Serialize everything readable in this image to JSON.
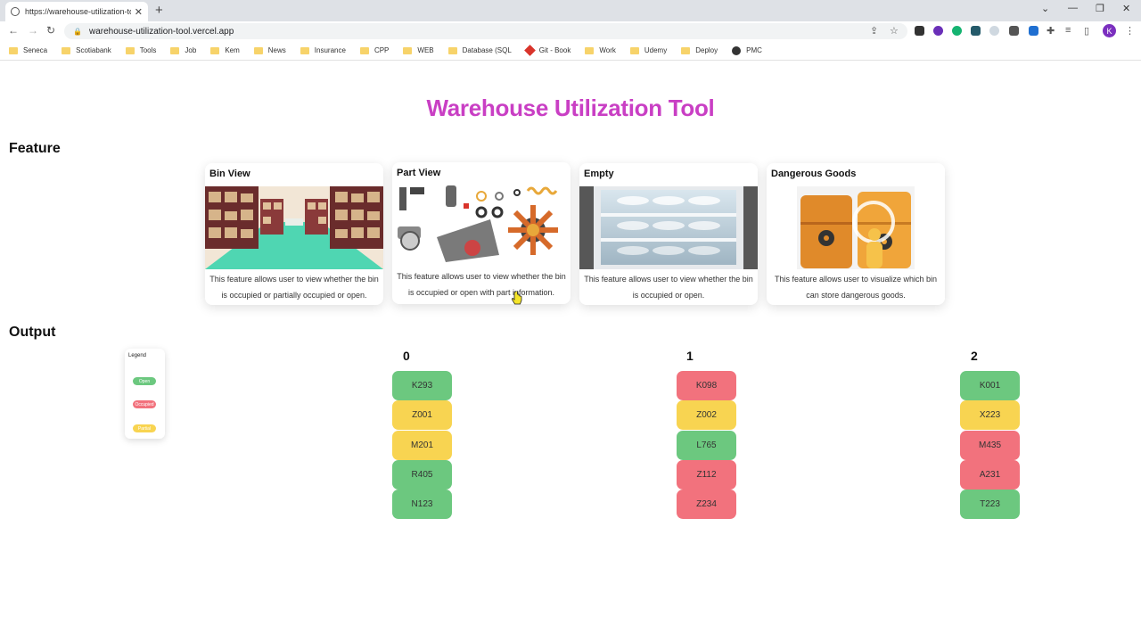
{
  "browser": {
    "tab_title": "https://warehouse-utilization-to...",
    "url": "warehouse-utilization-tool.vercel.app",
    "profile_initial": "K",
    "bookmarks": [
      "Seneca",
      "Scotiabank",
      "Tools",
      "Job",
      "Kem",
      "News",
      "Insurance",
      "CPP",
      "WEB",
      "Database (SQL",
      "Git - Book",
      "Work",
      "Udemy",
      "Deploy",
      "PMC"
    ]
  },
  "page": {
    "title": "Warehouse Utilization Tool",
    "feature_heading": "Feature",
    "output_heading": "Output"
  },
  "features": [
    {
      "title": "Bin View",
      "description": "This feature allows user to view whether the bin is occupied or partially occupied or open.",
      "image": "warehouse-shelves-illustration"
    },
    {
      "title": "Part View",
      "description": "This feature allows user to view whether the bin is occupied or open with part information.",
      "image": "machine-parts-illustration"
    },
    {
      "title": "Empty",
      "description": "This feature allows user to view whether the bin is occupied or open.",
      "image": "empty-shelf-illustration"
    },
    {
      "title": "Dangerous Goods",
      "description": "This feature allows user to visualize which bin can store dangerous goods.",
      "image": "hazard-barrels-illustration"
    }
  ],
  "legend": {
    "title": "Legend",
    "items": [
      {
        "label": "Open",
        "color": "#6cc87f"
      },
      {
        "label": "Occupied",
        "color": "#f2727d"
      },
      {
        "label": "Partial",
        "color": "#f8d451"
      }
    ]
  },
  "colors": {
    "open": "#6cc87f",
    "occupied": "#f2727d",
    "partial": "#f8d451",
    "title": "#c93fc4"
  },
  "output": {
    "columns": [
      {
        "label": "0",
        "bins": [
          {
            "code": "K293",
            "status": "open"
          },
          {
            "code": "Z001",
            "status": "partial"
          },
          {
            "code": "M201",
            "status": "partial"
          },
          {
            "code": "R405",
            "status": "open"
          },
          {
            "code": "N123",
            "status": "open"
          }
        ]
      },
      {
        "label": "1",
        "bins": [
          {
            "code": "K098",
            "status": "occupied"
          },
          {
            "code": "Z002",
            "status": "partial"
          },
          {
            "code": "L765",
            "status": "open"
          },
          {
            "code": "Z112",
            "status": "occupied"
          },
          {
            "code": "Z234",
            "status": "occupied"
          }
        ]
      },
      {
        "label": "2",
        "bins": [
          {
            "code": "K001",
            "status": "open"
          },
          {
            "code": "X223",
            "status": "partial"
          },
          {
            "code": "M435",
            "status": "occupied"
          },
          {
            "code": "A231",
            "status": "occupied"
          },
          {
            "code": "T223",
            "status": "open"
          }
        ]
      }
    ]
  }
}
